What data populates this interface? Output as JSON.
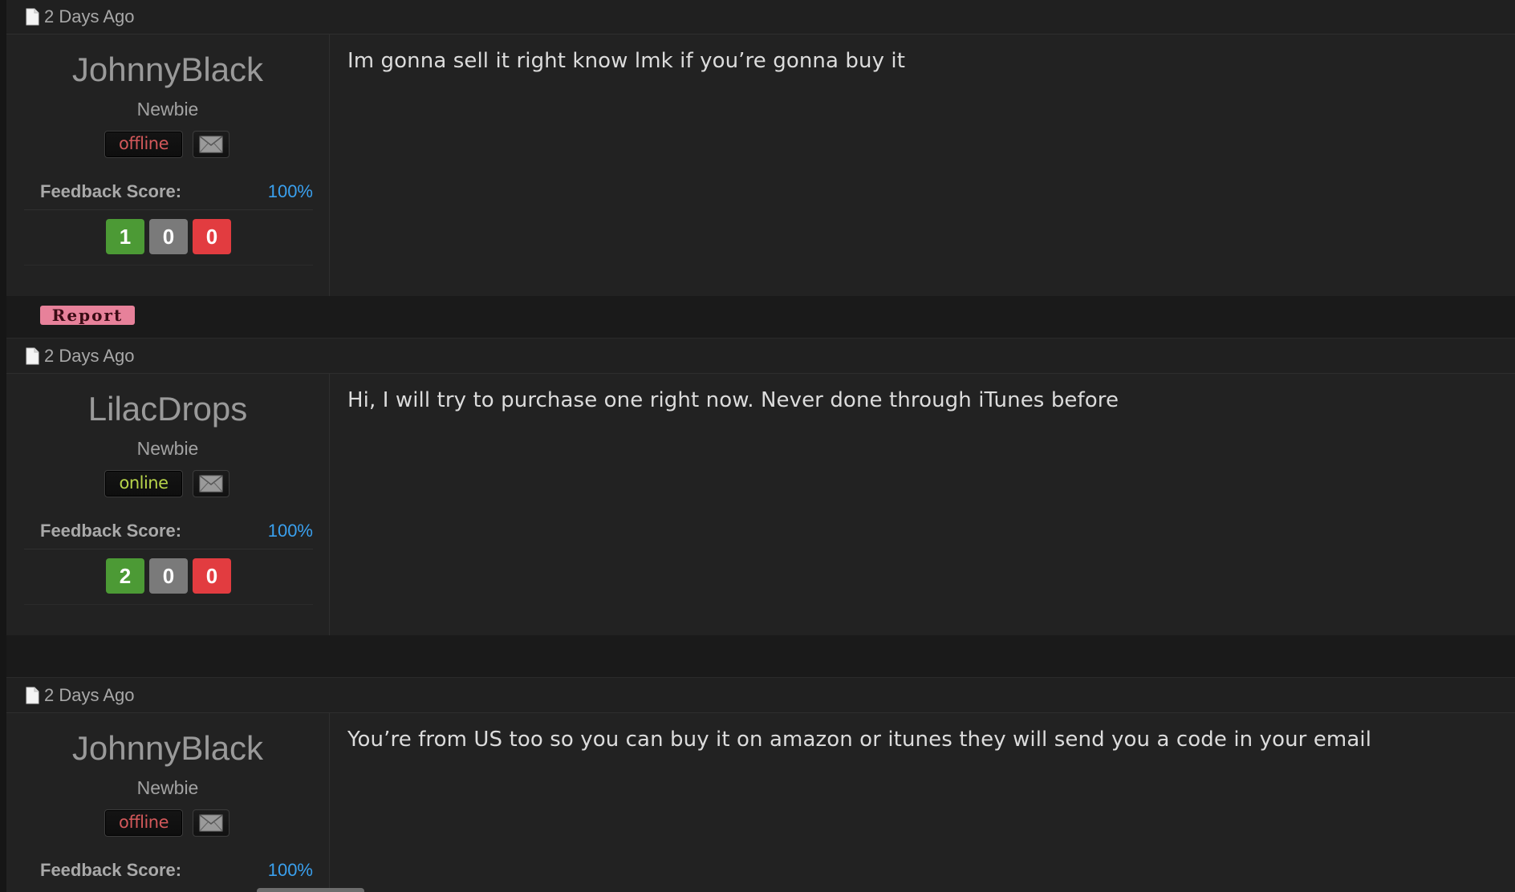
{
  "posts": [
    {
      "date": "2 Days Ago",
      "username": "JohnnyBlack",
      "usertitle": "Newbie",
      "status": "offline",
      "feedback_label": "Feedback Score:",
      "feedback_score": "100%",
      "feedback_positive": "1",
      "feedback_neutral": "0",
      "feedback_negative": "0",
      "message": "Im gonna sell it right know lmk if you’re gonna buy it",
      "report_label": "Report"
    },
    {
      "date": "2 Days Ago",
      "username": "LilacDrops",
      "usertitle": "Newbie",
      "status": "online",
      "feedback_label": "Feedback Score:",
      "feedback_score": "100%",
      "feedback_positive": "2",
      "feedback_neutral": "0",
      "feedback_negative": "0",
      "message": "Hi, I will try to purchase one right now. Never done through iTunes before"
    },
    {
      "date": "2 Days Ago",
      "username": "JohnnyBlack",
      "usertitle": "Newbie",
      "status": "offline",
      "feedback_label": "Feedback Score:",
      "feedback_score": "100%",
      "message": "You’re from US too so you can buy it on amazon or itunes they will send you a code in your email"
    }
  ],
  "icons": {
    "post_icon": "document-icon",
    "pm_icon": "envelope-icon"
  },
  "colors": {
    "feedback_score": "#3aa0ee",
    "positive": "#4c9a35",
    "neutral": "#7a7a7a",
    "negative": "#e23c40",
    "offline": "#d2585a",
    "online": "#b7d34a",
    "report": "#e7819a"
  }
}
